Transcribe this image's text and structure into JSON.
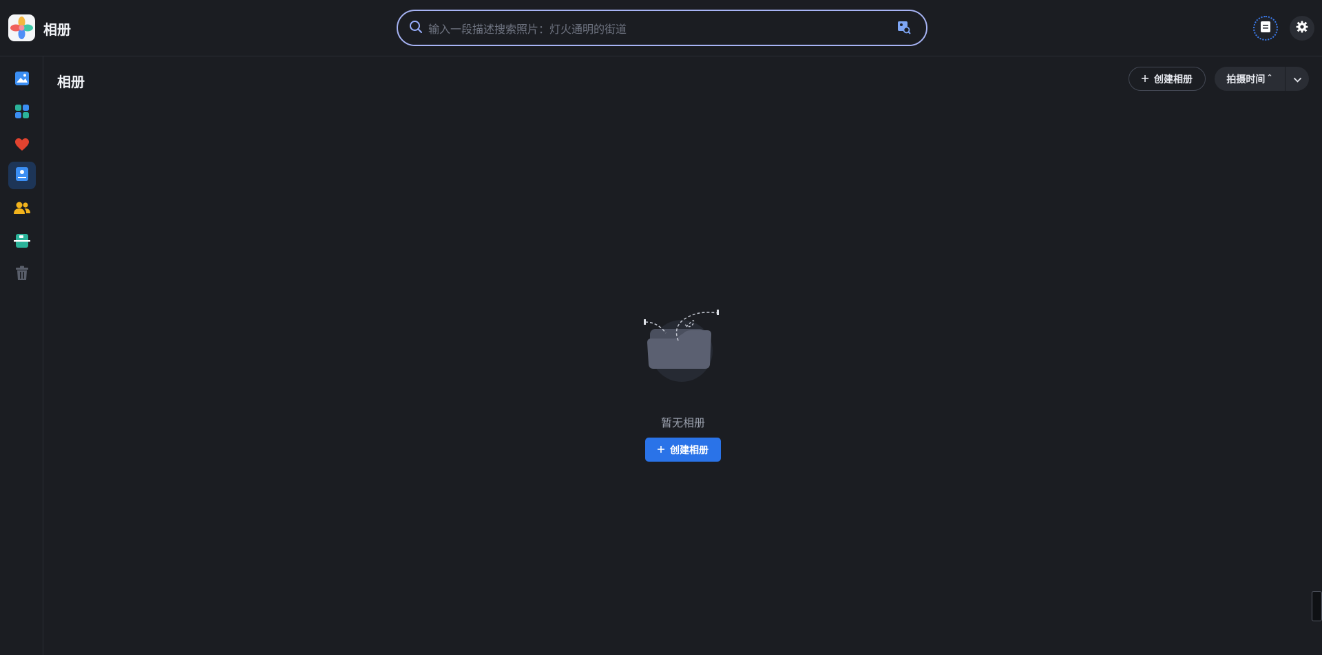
{
  "app": {
    "title": "相册"
  },
  "search": {
    "placeholder": "输入一段描述搜索照片：灯火通明的街道",
    "value": ""
  },
  "header_actions": [
    {
      "icon": "task-list-icon"
    },
    {
      "icon": "gear-icon"
    }
  ],
  "sidebar": {
    "items": [
      {
        "icon": "photos-icon",
        "active": false
      },
      {
        "icon": "apps-grid-icon",
        "active": false
      },
      {
        "icon": "heart-icon",
        "active": false
      },
      {
        "icon": "album-icon",
        "active": true
      },
      {
        "icon": "people-icon",
        "active": false
      },
      {
        "icon": "screenshot-icon",
        "active": false
      },
      {
        "icon": "trash-icon",
        "active": false
      }
    ]
  },
  "page": {
    "title": "相册",
    "create_album_label": "创建相册",
    "sort_label": "拍摄时间",
    "sort_indicator": "⌃"
  },
  "empty_state": {
    "text": "暂无相册",
    "button_label": "创建相册"
  },
  "colors": {
    "background": "#1b1d22",
    "accent": "#2a73e8",
    "search_border": "#a7b4f5"
  }
}
